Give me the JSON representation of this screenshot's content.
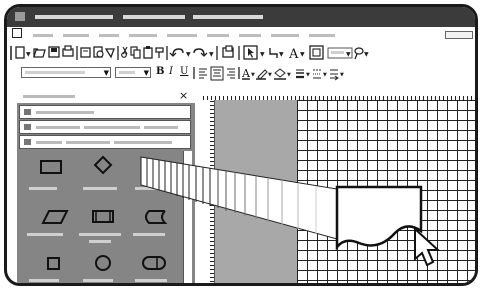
{
  "toolbar": {
    "fmt_bold": "B",
    "fmt_italic": "I",
    "fmt_underline": "U",
    "font_color_glyph": "A"
  },
  "panel": {
    "close_glyph": "×"
  },
  "icons": {
    "app": "app-icon",
    "new": "new-document-icon",
    "open": "open-folder-icon",
    "save": "save-icon",
    "print": "print-icon",
    "undo": "undo-icon",
    "redo": "redo-icon",
    "pointer": "pointer-tool-icon",
    "connector": "connector-tool-icon",
    "text": "text-tool-icon",
    "cursor": "mouse-cursor-icon"
  },
  "shapes": [
    "rectangle",
    "diamond",
    "blank",
    "parallelogram",
    "process",
    "stored-data",
    "square",
    "circle",
    "terminator"
  ],
  "colors": {
    "titlebar": "#3b3b3b",
    "panel": "#858585",
    "page_margin": "#a8a8a8",
    "grid_line": "#222222"
  }
}
